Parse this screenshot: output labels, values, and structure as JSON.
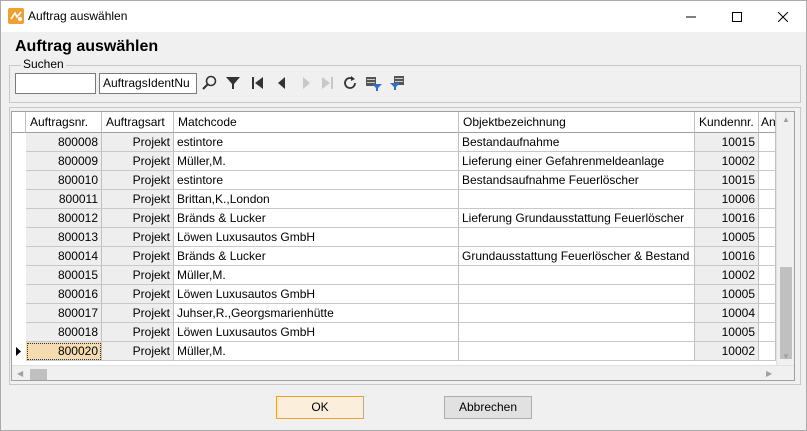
{
  "window": {
    "title": "Auftrag auswählen"
  },
  "dialog": {
    "title": "Auftrag auswählen"
  },
  "search": {
    "group_label": "Suchen",
    "query_value": "",
    "field_value": "AuftragsIdentNu"
  },
  "toolbar": {
    "icons": [
      "search-icon",
      "filter-icon",
      "first-record-icon",
      "previous-record-icon",
      "next-record-icon",
      "last-record-icon",
      "refresh-icon",
      "apply-filter-icon",
      "edit-filter-icon"
    ]
  },
  "table": {
    "headers": [
      "Auftragsnr.",
      "Auftragsart",
      "Matchcode",
      "Objektbezeichnung",
      "Kundennr.",
      "Anl"
    ],
    "rows": [
      [
        "800008",
        "Projekt",
        "estintore",
        "Bestandaufnahme",
        "10015"
      ],
      [
        "800009",
        "Projekt",
        "Müller,M.",
        "Lieferung einer Gefahrenmeldeanlage",
        "10002"
      ],
      [
        "800010",
        "Projekt",
        "estintore",
        "Bestandsaufnahme Feuerlöscher",
        "10015"
      ],
      [
        "800011",
        "Projekt",
        "Brittan,K.,London",
        "",
        "10006"
      ],
      [
        "800012",
        "Projekt",
        "Bränds & Lucker",
        "Lieferung Grundausstattung Feuerlöscher",
        "10016"
      ],
      [
        "800013",
        "Projekt",
        "Löwen Luxusautos GmbH",
        "",
        "10005"
      ],
      [
        "800014",
        "Projekt",
        "Bränds & Lucker",
        "Grundausstattung Feuerlöscher & Bestand",
        "10016"
      ],
      [
        "800015",
        "Projekt",
        "Müller,M.",
        "",
        "10002"
      ],
      [
        "800016",
        "Projekt",
        "Löwen Luxusautos GmbH",
        "",
        "10005"
      ],
      [
        "800017",
        "Projekt",
        "Juhser,R.,Georgsmarienhütte",
        "",
        "10004"
      ],
      [
        "800018",
        "Projekt",
        "Löwen Luxusautos GmbH",
        "",
        "10005"
      ],
      [
        "800020",
        "Projekt",
        "Müller,M.",
        "",
        "10002"
      ]
    ],
    "selected_row": 11
  },
  "buttons": {
    "ok": "OK",
    "cancel": "Abbrechen"
  },
  "colors": {
    "accent": "#f0a030",
    "selected_cell": "#f5dcb0"
  }
}
